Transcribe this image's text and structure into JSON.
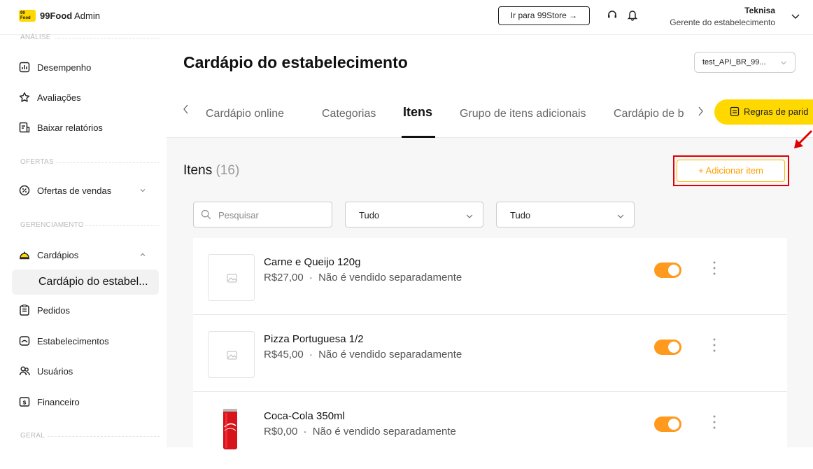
{
  "header": {
    "logo_badge": "99 Food",
    "logo_brand": "99Food",
    "logo_suffix": " Admin",
    "store_button": "Ir para 99Store →",
    "user_name": "Teknisa",
    "user_role": "Gerente do estabelecimento"
  },
  "sidebar": {
    "sections": [
      {
        "label": "ANÁLISE"
      },
      {
        "label": "OFERTAS"
      },
      {
        "label": "GERENCIAMENTO"
      },
      {
        "label": "GERAL"
      }
    ],
    "items": [
      {
        "label": "Desempenho",
        "icon": "chart-icon"
      },
      {
        "label": "Avaliações",
        "icon": "star-icon"
      },
      {
        "label": "Baixar relatórios",
        "icon": "download-report-icon"
      },
      {
        "label": "Ofertas de vendas",
        "icon": "offer-icon"
      },
      {
        "label": "Cardápios",
        "icon": "cloche-icon"
      },
      {
        "label": "Cardápio do estabel...",
        "active": true
      },
      {
        "label": "Pedidos",
        "icon": "clipboard-icon"
      },
      {
        "label": "Estabelecimentos",
        "icon": "store-icon"
      },
      {
        "label": "Usuários",
        "icon": "users-icon"
      },
      {
        "label": "Financeiro",
        "icon": "money-icon"
      }
    ]
  },
  "main": {
    "title": "Cardápio do estabelecimento",
    "store_select": "test_API_BR_99...",
    "tabs": [
      {
        "label": "Cardápio online"
      },
      {
        "label": "Categorias"
      },
      {
        "label": "Itens",
        "active": true
      },
      {
        "label": "Grupo de itens adicionais"
      },
      {
        "label": "Cardápio de b"
      }
    ],
    "rules_button": "Regras de parid",
    "items_title": "Itens",
    "items_count": "(16)",
    "add_button": "+ Adicionar item",
    "search_placeholder": "Pesquisar",
    "filter1": "Tudo",
    "filter2": "Tudo",
    "items": [
      {
        "name": "Carne e Queijo 120g",
        "price": "R$27,00",
        "sep": "·",
        "note": "Não é vendido separadamente",
        "enabled": true
      },
      {
        "name": "Pizza Portuguesa 1/2",
        "price": "R$45,00",
        "sep": "·",
        "note": "Não é vendido separadamente",
        "enabled": true
      },
      {
        "name": "Coca-Cola 350ml",
        "price": "R$0,00",
        "sep": "·",
        "note": "Não é vendido separadamente",
        "enabled": true
      }
    ]
  },
  "colors": {
    "accent_yellow": "#ffd800",
    "toggle_orange": "#ff9a1e",
    "add_button_orange": "#ff9e00",
    "highlight_red": "#e00000"
  }
}
